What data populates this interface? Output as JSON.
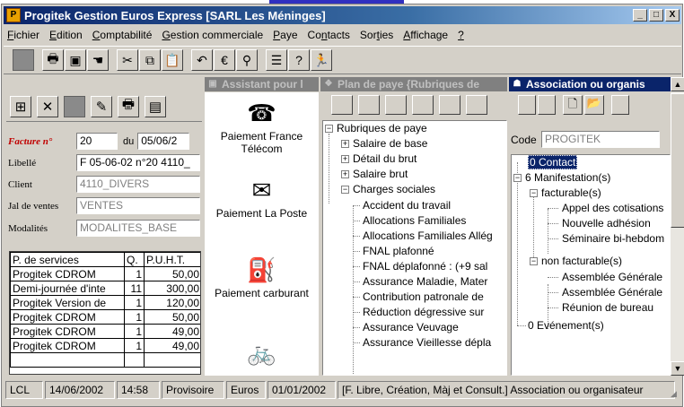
{
  "window": {
    "title": "Progitek Gestion Euros Express [SARL Les Méninges]",
    "minimize": "_",
    "maximize": "□",
    "close": "X"
  },
  "menu": {
    "items": [
      {
        "u": "F",
        "rest": "ichier"
      },
      {
        "u": "E",
        "rest": "dition"
      },
      {
        "u": "C",
        "rest": "omptabilité"
      },
      {
        "u": "G",
        "rest": "estion commerciale"
      },
      {
        "u": "P",
        "rest": "aye"
      },
      {
        "pre": "Co",
        "u": "n",
        "rest": "tacts"
      },
      {
        "pre": "Sor",
        "u": "t",
        "rest": "ies"
      },
      {
        "u": "A",
        "rest": "ffichage"
      },
      {
        "u": "?",
        "rest": ""
      }
    ]
  },
  "toolbar": {
    "icons": [
      "blank-icon",
      "printer-icon",
      "save-icon",
      "hand-icon",
      "cut-icon",
      "copy-icon",
      "paste-icon",
      "undo-icon",
      "euro-icon",
      "search-icon",
      "properties-icon",
      "help-icon",
      "exit-icon"
    ]
  },
  "invoice": {
    "facture_label": "Facture n°",
    "facture_value": "20",
    "du_label": "du",
    "date_value": "05/06/2",
    "libelle_label": "Libellé",
    "libelle_value": "F 05-06-02 n°20 4110_",
    "client_label": "Client",
    "client_value": "4110_DIVERS",
    "journal_label": "Jal de ventes",
    "journal_value": "VENTES",
    "modalites_label": "Modalités",
    "modalites_value": "MODALITES_BASE",
    "table": {
      "headers": [
        "P. de services",
        "Q.",
        "P.U.H.T."
      ],
      "rows": [
        [
          "Progitek CDROM",
          "1",
          "50,00"
        ],
        [
          "Demi-journée d'inte",
          "11",
          "300,00"
        ],
        [
          "Progitek Version de",
          "1",
          "120,00"
        ],
        [
          "Progitek CDROM",
          "1",
          "50,00"
        ],
        [
          "Progitek CDROM",
          "1",
          "49,00"
        ],
        [
          "Progitek CDROM",
          "1",
          "49,00"
        ]
      ]
    }
  },
  "assistant": {
    "title": "Assistant pour l",
    "items": [
      {
        "label": "Paiement France Télécom",
        "icon": "telephone-icon"
      },
      {
        "label": "Paiement La Poste",
        "icon": "envelope-icon"
      },
      {
        "label": "Paiement carburant",
        "icon": "fuel-pump-icon"
      },
      {
        "label": "",
        "icon": "bicycle-icon"
      }
    ]
  },
  "plan": {
    "title": "Plan de paye {Rubriques de",
    "tree": {
      "root": "Rubriques de paye",
      "children": [
        "Salaire de base",
        "Détail du brut",
        "Salaire brut",
        "Charges sociales"
      ],
      "charges": [
        "Accident du travail",
        "Allocations Familiales",
        "Allocations Familiales Allég",
        "FNAL plafonné",
        "FNAL déplafonné : (+9 sal",
        "Assurance Maladie, Mater",
        "Contribution patronale de",
        "Réduction dégressive sur",
        "Assurance Veuvage",
        "Assurance Vieillesse dépla"
      ]
    }
  },
  "association": {
    "title": "Association ou organis",
    "code_label": "Code",
    "code_value": "PROGITEK",
    "tree": {
      "contact": "0 Contact",
      "manifestation": "6 Manifestation(s)",
      "facturable": "facturable(s)",
      "facturable_items": [
        "Appel des cotisations",
        "Nouvelle adhésion",
        "Séminaire bi-hebdom"
      ],
      "non_facturable": "non facturable(s)",
      "non_facturable_items": [
        "Assemblée Générale",
        "Assemblée Générale",
        "Réunion de bureau"
      ],
      "evenement": "0 Evénement(s)"
    }
  },
  "status": {
    "fields": [
      "LCL",
      "14/06/2002",
      "14:58",
      "Provisoire",
      "Euros",
      "01/01/2002",
      "[F. Libre, Création, Màj et Consult.] Association ou organisateur"
    ]
  }
}
